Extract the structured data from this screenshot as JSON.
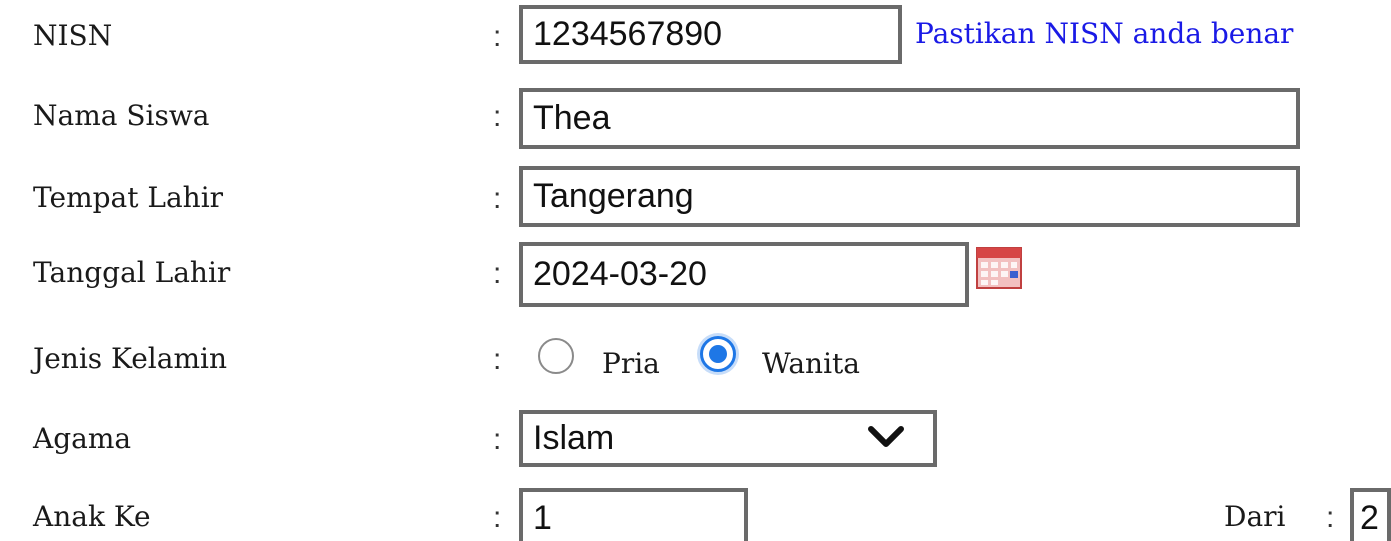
{
  "form": {
    "nisn": {
      "label": "NISN",
      "value": "1234567890",
      "hint": "Pastikan NISN anda benar"
    },
    "nama_siswa": {
      "label": "Nama Siswa",
      "value": "Thea"
    },
    "tempat_lahir": {
      "label": "Tempat Lahir",
      "value": "Tangerang"
    },
    "tanggal_lahir": {
      "label": "Tanggal Lahir",
      "value": "2024-03-20",
      "icon": "calendar-icon"
    },
    "jenis_kelamin": {
      "label": "Jenis Kelamin",
      "option_pria": "Pria",
      "option_wanita": "Wanita",
      "selected": "Wanita"
    },
    "agama": {
      "label": "Agama",
      "value": "Islam",
      "icon": "chevron-down-icon"
    },
    "anak_ke": {
      "label": "Anak Ke",
      "value": "1",
      "dari_label": "Dari",
      "dari_value": "2"
    },
    "colon": ":"
  },
  "colors": {
    "hint_text": "#1a1ae6",
    "radio_accent": "#1e77e6",
    "field_border": "#6a6a6a"
  }
}
